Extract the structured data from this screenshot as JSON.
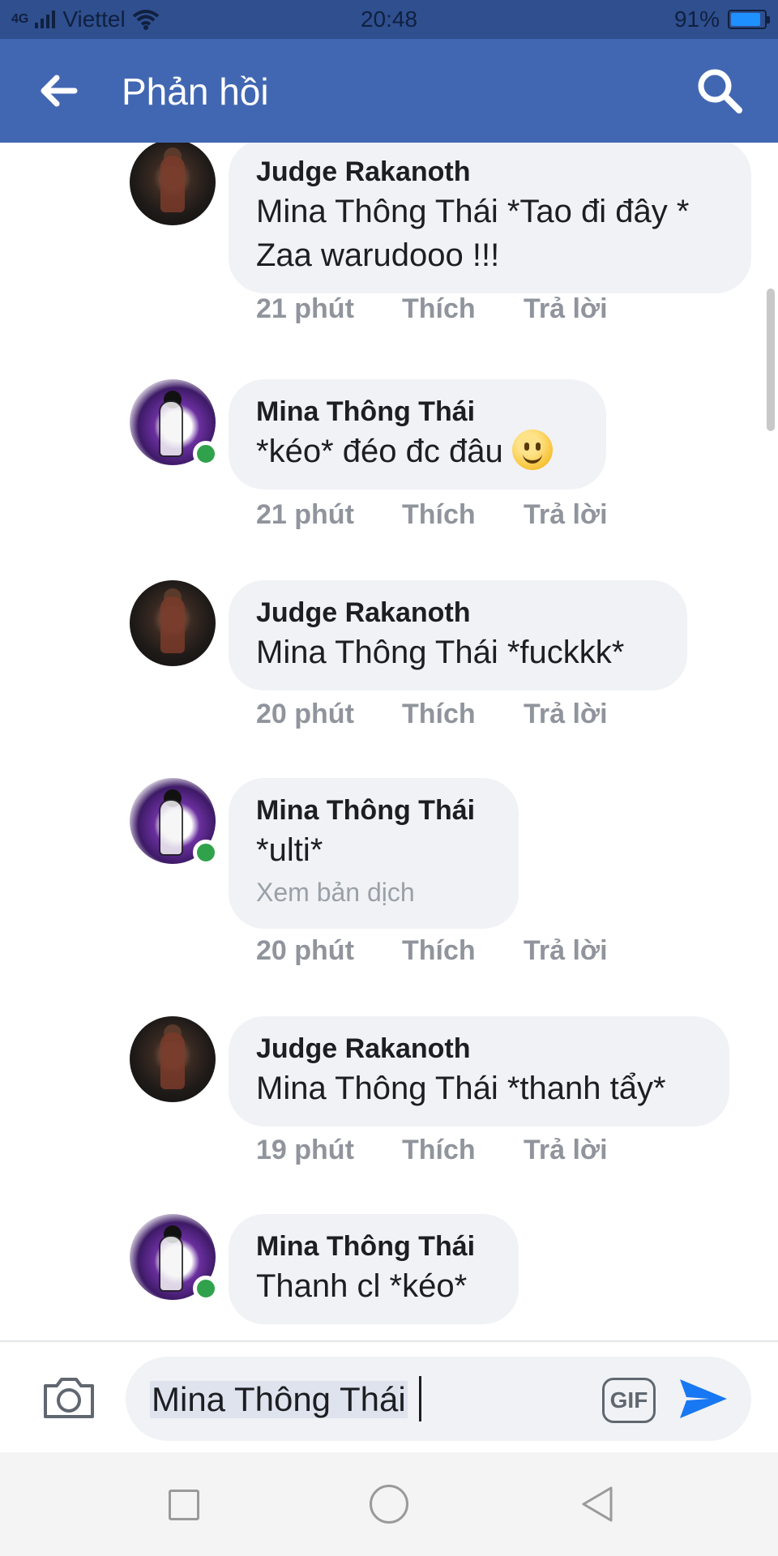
{
  "status_bar": {
    "network": "4G",
    "carrier": "Viettel",
    "time": "20:48",
    "battery_percent": "91%",
    "battery_level": 0.91
  },
  "header": {
    "title": "Phản hồi",
    "back_icon": "arrow-left-icon",
    "search_icon": "search-icon"
  },
  "comments": [
    {
      "author": "Judge Rakanoth",
      "text": "Mina Thông Thái *Tao đi đây * Zaa warudooo !!!",
      "time": "21 phút",
      "like": "Thích",
      "reply": "Trả lời",
      "online": false
    },
    {
      "author": "Mina Thông Thái",
      "text": "*kéo* đéo đc đâu",
      "emoji": "slightly-smiling-face-icon",
      "time": "21 phút",
      "like": "Thích",
      "reply": "Trả lời",
      "online": true
    },
    {
      "author": "Judge Rakanoth",
      "text": "Mina Thông Thái *fuckkk*",
      "time": "20 phút",
      "like": "Thích",
      "reply": "Trả lời",
      "online": false
    },
    {
      "author": "Mina Thông Thái",
      "text": "*ulti*",
      "translate": "Xem bản dịch",
      "time": "20 phút",
      "like": "Thích",
      "reply": "Trả lời",
      "online": true
    },
    {
      "author": "Judge Rakanoth",
      "text": "Mina Thông Thái *thanh tẩy*",
      "time": "19 phút",
      "like": "Thích",
      "reply": "Trả lời",
      "online": false
    },
    {
      "author": "Mina Thông Thái",
      "text": "Thanh cl *kéo*",
      "time": "",
      "like": "",
      "reply": "",
      "online": true
    }
  ],
  "composer": {
    "input_value": "Mina Thông Thái",
    "gif_label": "GIF",
    "camera_icon": "camera-icon",
    "send_icon": "send-icon"
  },
  "colors": {
    "header": "#4267b2",
    "bubble": "#f0f2f5",
    "online": "#31a24c",
    "send": "#1877f2"
  }
}
